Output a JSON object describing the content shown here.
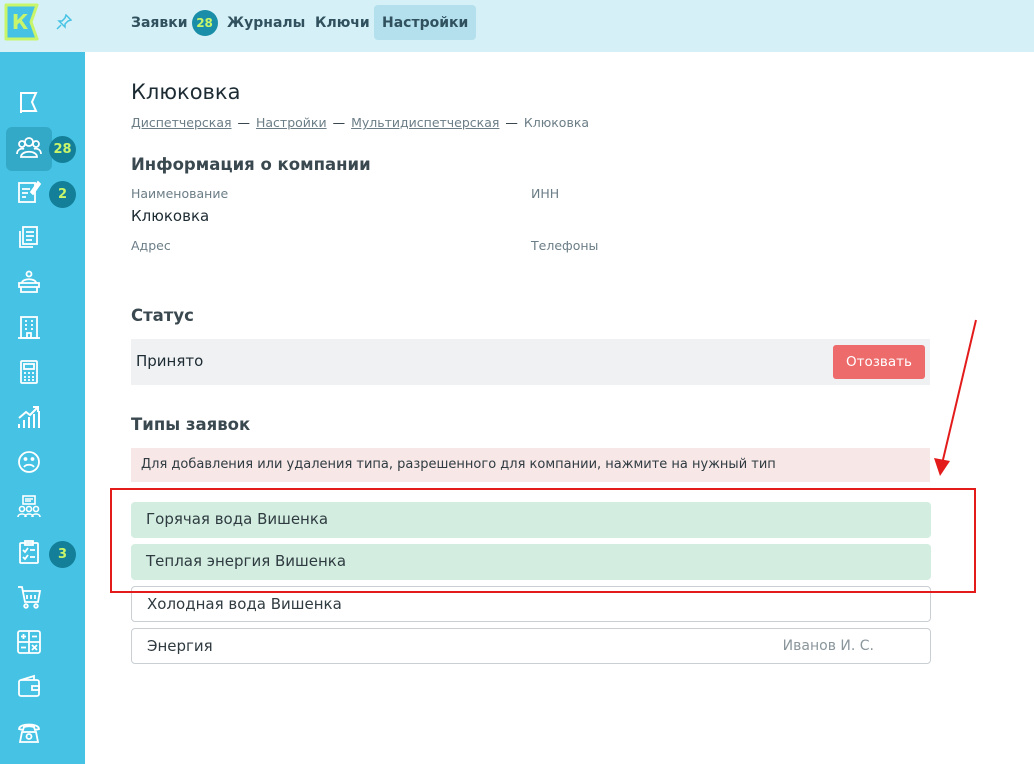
{
  "colors": {
    "sidebar": "#46c3e4",
    "topbar": "#d5f1f7",
    "badge": "#137f99",
    "revoke": "#ee6b6b",
    "selected_type": "#d3eee0",
    "annotation": "#e31b1b"
  },
  "logo": {
    "letter": "К"
  },
  "sidebar": {
    "items": [
      {
        "icon": "flag-icon"
      },
      {
        "icon": "users-group-icon",
        "badge": "28",
        "active": true
      },
      {
        "icon": "edit-note-icon",
        "badge": "2"
      },
      {
        "icon": "documents-icon"
      },
      {
        "icon": "dispatcher-icon"
      },
      {
        "icon": "building-icon"
      },
      {
        "icon": "calculator-icon"
      },
      {
        "icon": "chart-growth-icon"
      },
      {
        "icon": "sad-face-icon"
      },
      {
        "icon": "team-icon"
      },
      {
        "icon": "clipboard-check-icon",
        "badge": "3"
      },
      {
        "icon": "cart-icon"
      },
      {
        "icon": "math-icon"
      },
      {
        "icon": "wallet-icon"
      },
      {
        "icon": "phone-icon"
      }
    ]
  },
  "tabs": [
    {
      "label": "Заявки",
      "badge": "28"
    },
    {
      "label": "Журналы"
    },
    {
      "label": "Ключи"
    },
    {
      "label": "Настройки",
      "active": true
    }
  ],
  "page": {
    "title": "Клюковка",
    "breadcrumb": [
      "Диспетчерская",
      "Настройки",
      "Мультидиспетчерская",
      "Клюковка"
    ],
    "breadcrumb_sep": "—"
  },
  "company": {
    "heading": "Информация о компании",
    "name_label": "Наименование",
    "name_value": "Клюковка",
    "inn_label": "ИНН",
    "address_label": "Адрес",
    "phones_label": "Телефоны"
  },
  "status": {
    "heading": "Статус",
    "value": "Принято",
    "revoke_label": "Отозвать"
  },
  "types": {
    "heading": "Типы заявок",
    "hint": "Для добавления или удаления типа, разрешенного для компании, нажмите на нужный тип",
    "items": [
      {
        "label": "Горячая вода Вишенка",
        "selected": true
      },
      {
        "label": "Теплая энергия Вишенка",
        "selected": true
      },
      {
        "label": "Холодная вода Вишенка",
        "selected": false
      },
      {
        "label": "Энергия",
        "selected": false,
        "author": "Иванов И. С."
      }
    ]
  }
}
